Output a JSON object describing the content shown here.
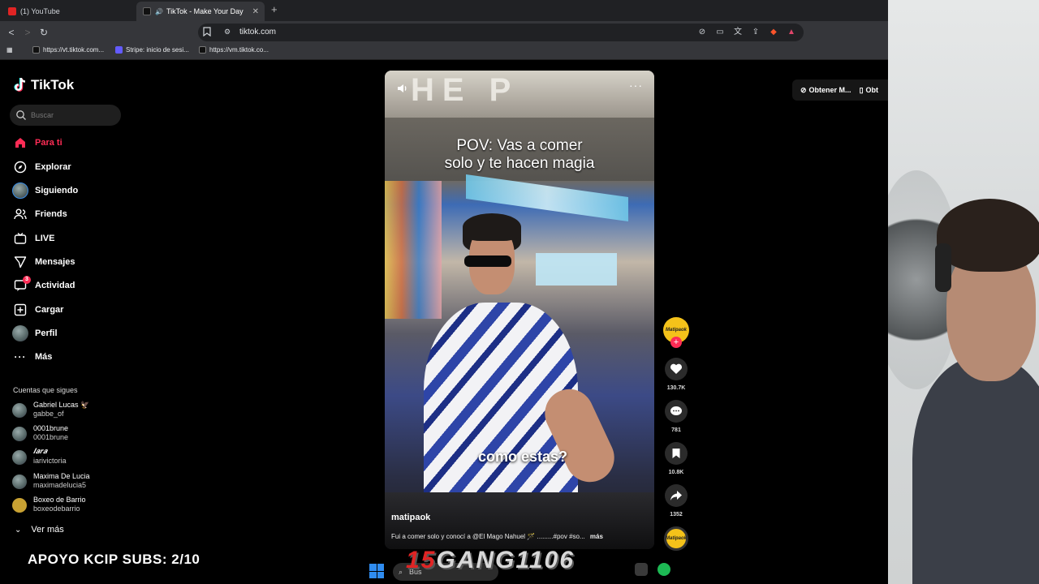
{
  "browser": {
    "tabs": [
      {
        "label": "(1) YouTube",
        "active": false
      },
      {
        "label": "TikTok - Make Your Day",
        "active": true
      }
    ],
    "url": "tiktok.com",
    "bookmarks": [
      "https://vt.tiktok.com...",
      "Stripe: inicio de sesi...",
      "https://vm.tiktok.co..."
    ]
  },
  "sidebar": {
    "brand": "TikTok",
    "search_placeholder": "Buscar",
    "nav": [
      {
        "label": "Para ti",
        "icon": "home-icon",
        "active": true
      },
      {
        "label": "Explorar",
        "icon": "compass-icon"
      },
      {
        "label": "Siguiendo",
        "icon": "following-avatar"
      },
      {
        "label": "Friends",
        "icon": "friends-icon"
      },
      {
        "label": "LIVE",
        "icon": "live-icon"
      },
      {
        "label": "Mensajes",
        "icon": "send-icon"
      },
      {
        "label": "Actividad",
        "icon": "activity-icon",
        "badge": "3"
      },
      {
        "label": "Cargar",
        "icon": "upload-icon"
      },
      {
        "label": "Perfil",
        "icon": "profile-avatar"
      },
      {
        "label": "Más",
        "icon": "more-icon"
      }
    ],
    "following_title": "Cuentas que sigues",
    "accounts": [
      {
        "name": "Gabriel Lucas 🦅",
        "handle": "gabbe_of"
      },
      {
        "name": "0001brune",
        "handle": "0001brune"
      },
      {
        "name": "𝑰𝒂𝒓𝒂",
        "handle": "iarivictoria"
      },
      {
        "name": "Maxima De Lucia",
        "handle": "maximadelucia5"
      },
      {
        "name": "Boxeo de Barrio",
        "handle": "boxeodebarrio"
      }
    ],
    "see_more": "Ver más"
  },
  "video": {
    "caption_line1": "POV: Vas a comer",
    "caption_line2": "solo y te hacen magia",
    "subtitle": "como estas?",
    "author": "matipaok",
    "description": "Fui a comer solo y conocí a @El Mago Nahuel 🪄 .........#pov #so...",
    "more": "más",
    "creator_avatar_text": "Matipaok"
  },
  "actions": {
    "likes": "130.7K",
    "comments": "781",
    "saves": "10.8K",
    "shares": "1352"
  },
  "topright": {
    "get_app": "Obtener M...",
    "get_app2": "Obt"
  },
  "stream": {
    "overlay_text": "APOYO KCIP SUBS: 2/10",
    "brand_logo_num": "15",
    "brand_logo_text": "GANG1106",
    "taskbar_search": "Bus"
  },
  "colors": {
    "accent": "#fe2c55",
    "background": "#000000",
    "creator_yellow": "#f4c21a"
  }
}
